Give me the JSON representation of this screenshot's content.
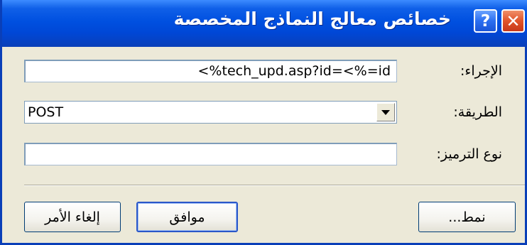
{
  "window": {
    "title": "خصائص معالج النماذج المخصصة",
    "help_symbol": "?",
    "close_symbol": "✕"
  },
  "form": {
    "action": {
      "label": "الإجراء:",
      "value": "<%tech_upd.asp?id=<%=id"
    },
    "method": {
      "label": "الطريقة:",
      "value": "POST"
    },
    "encoding": {
      "label": "نوع الترميز:",
      "value": ""
    }
  },
  "buttons": {
    "style": "نمط...",
    "ok": "موافق",
    "cancel": "إلغاء الأمر"
  },
  "colors": {
    "titlebar": "#0050e0",
    "dialog_bg": "#ece9d8",
    "close_button": "#e0542a",
    "help_button": "#2c6ff0"
  }
}
